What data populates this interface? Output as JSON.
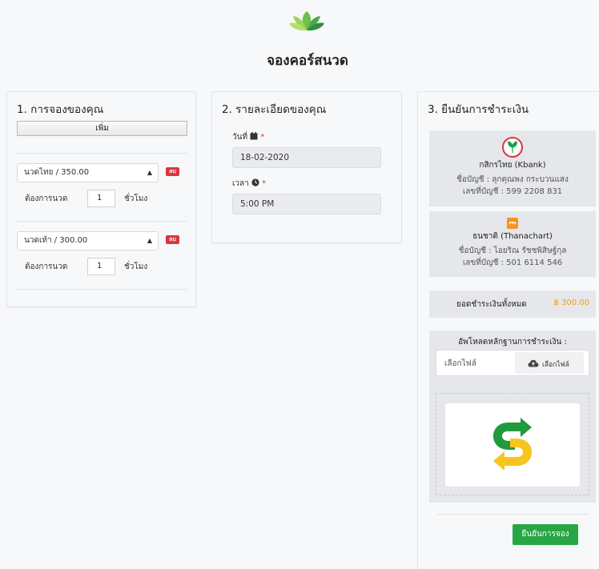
{
  "header": {
    "title": "จองคอร์สนวด"
  },
  "booking": {
    "heading": "1. การจองของคุณ",
    "add_label": "เพิ่ม",
    "items": [
      {
        "service": "นวดไทย / 350.00",
        "delete_label": "ลบ",
        "qty_label": "ต้องการนวด",
        "qty": "1",
        "unit": "ชั่วโมง"
      },
      {
        "service": "นวดเท้า / 300.00",
        "delete_label": "ลบ",
        "qty_label": "ต้องการนวด",
        "qty": "1",
        "unit": "ชั่วโมง"
      }
    ]
  },
  "details": {
    "heading": "2. รายละเอียดของคุณ",
    "date_label": "วันที่",
    "date_value": "18-02-2020",
    "time_label": "เวลา",
    "time_value": "5:00 PM",
    "required_mark": "*"
  },
  "payment": {
    "heading": "3. ยืนยันการชำระเงิน",
    "banks": [
      {
        "name": "กสิกรไทย (Kbank)",
        "account_name": "ชื่อบัญชี : ลุกตุณพง กระบวนแสง",
        "account_no": "เลขที่บัญชี : 599 2208 831",
        "color": "#1ba345"
      },
      {
        "name": "ธนชาติ (Thanachart)",
        "account_name": "ชื่อบัญชี : ไอยริณ รัชชพิสิษฐ์กุล",
        "account_no": "เลขที่บัญชี : 501 6114 546",
        "color": "#f7931e"
      }
    ],
    "total_label": "ยอดชำระเงินทั้งหมด",
    "total_value": "฿ 300.00",
    "upload_label": "อัพโหลดหลักฐานการชำระเงิน :",
    "file_placeholder": "เลือกไฟล์",
    "file_button": "เลือกไฟล์",
    "confirm_label": "ยืนยันการจอง"
  },
  "colors": {
    "accent_green": "#27a744",
    "delete_red": "#d9363e",
    "total_orange": "#f0a020"
  }
}
